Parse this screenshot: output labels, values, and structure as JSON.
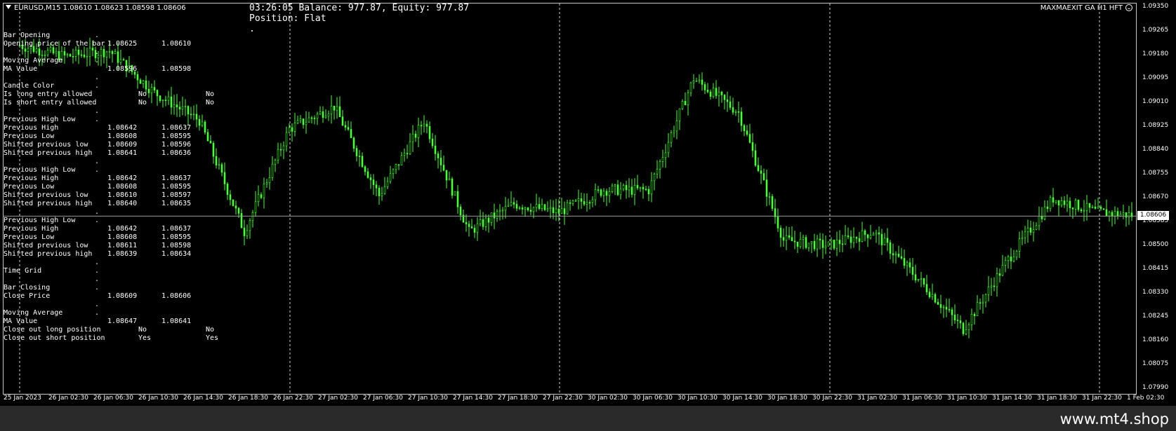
{
  "header": {
    "symbol_info": "EURUSD,M15  1.08610 1.08623 1.08598 1.08606",
    "ea_name": "MAXMAEXIT GA H1 HFT",
    "ea_icon": "smiley-icon"
  },
  "status": {
    "line1": "03:26:05 Balance: 977.87, Equity: 977.87",
    "line2": "Position: Flat",
    "line3": "."
  },
  "panel": {
    "rows": [
      {
        "label": "Bar Opening",
        "dot": "."
      },
      {
        "label": "Opening price of the bar",
        "v1": "1.08625",
        "v2": "1.08610"
      },
      {
        "label": "",
        "dot": "."
      },
      {
        "label": "Moving Average",
        "dot": "."
      },
      {
        "label": "MA Value",
        "v1": "1.08596",
        "v2": "1.08598"
      },
      {
        "label": "",
        "dot": "."
      },
      {
        "label": "Candle Color",
        "dot": "."
      },
      {
        "label": "Is long entry allowed",
        "b1": "No",
        "b2": "No"
      },
      {
        "label": "Is short entry allowed",
        "b1": "No",
        "b2": "No"
      },
      {
        "label": "",
        "dot": "."
      },
      {
        "label": "Previous High Low",
        "dot": "."
      },
      {
        "label": "Previous High",
        "v1": "1.08642",
        "v2": "1.08637"
      },
      {
        "label": "Previous Low",
        "v1": "1.08608",
        "v2": "1.08595"
      },
      {
        "label": "Shifted previous low",
        "v1": "1.08609",
        "v2": "1.08596"
      },
      {
        "label": "Shifted previous high",
        "v1": "1.08641",
        "v2": "1.08636"
      },
      {
        "label": "",
        "dot": "."
      },
      {
        "label": "Previous High Low",
        "dot": "."
      },
      {
        "label": "Previous High",
        "v1": "1.08642",
        "v2": "1.08637"
      },
      {
        "label": "Previous Low",
        "v1": "1.08608",
        "v2": "1.08595"
      },
      {
        "label": "Shifted previous low",
        "v1": "1.08610",
        "v2": "1.08597"
      },
      {
        "label": "Shifted previous high",
        "v1": "1.08640",
        "v2": "1.08635"
      },
      {
        "label": "",
        "dot": "."
      },
      {
        "label": "Previous High Low",
        "dot": "."
      },
      {
        "label": "Previous High",
        "v1": "1.08642",
        "v2": "1.08637"
      },
      {
        "label": "Previous Low",
        "v1": "1.08608",
        "v2": "1.08595"
      },
      {
        "label": "Shifted previous low",
        "v1": "1.08611",
        "v2": "1.08598"
      },
      {
        "label": "Shifted previous high",
        "v1": "1.08639",
        "v2": "1.08634"
      },
      {
        "label": "",
        "dot": "."
      },
      {
        "label": "Time Grid",
        "dot": "."
      },
      {
        "label": "",
        "dot": "."
      },
      {
        "label": "Bar Closing",
        "dot": "."
      },
      {
        "label": "Close Price",
        "v1": "1.08609",
        "v2": "1.08606"
      },
      {
        "label": "",
        "dot": "."
      },
      {
        "label": "Moving Average",
        "dot": "."
      },
      {
        "label": "MA Value",
        "v1": "1.08647",
        "v2": "1.08641"
      },
      {
        "label": "Close out long position",
        "b1": "No",
        "b2": "No"
      },
      {
        "label": "Close out short position",
        "b1": "Yes",
        "b2": "Yes"
      }
    ]
  },
  "price_axis": {
    "labels": [
      "1.09350",
      "1.09265",
      "1.09180",
      "1.09095",
      "1.09010",
      "1.08925",
      "1.08840",
      "1.08755",
      "1.08670",
      "1.08585",
      "1.08500",
      "1.08415",
      "1.08330",
      "1.08245",
      "1.08160",
      "1.08075",
      "1.07990"
    ],
    "current_price": "1.08606"
  },
  "time_axis": {
    "labels": [
      "25 Jan 2023",
      "26 Jan 02:30",
      "26 Jan 06:30",
      "26 Jan 10:30",
      "26 Jan 14:30",
      "26 Jan 18:30",
      "26 Jan 22:30",
      "27 Jan 02:30",
      "27 Jan 06:30",
      "27 Jan 10:30",
      "27 Jan 14:30",
      "27 Jan 18:30",
      "27 Jan 22:30",
      "30 Jan 02:30",
      "30 Jan 06:30",
      "30 Jan 10:30",
      "30 Jan 14:30",
      "30 Jan 18:30",
      "30 Jan 22:30",
      "31 Jan 02:30",
      "31 Jan 06:30",
      "31 Jan 10:30",
      "31 Jan 14:30",
      "31 Jan 18:30",
      "31 Jan 22:30",
      "1 Feb 02:30"
    ]
  },
  "chart_data": {
    "type": "candlestick",
    "symbol": "EURUSD",
    "timeframe": "M15",
    "ylim": [
      1.0799,
      1.0935
    ],
    "candle_color": "#4cff3a",
    "current_price": 1.08606,
    "path": [
      [
        "25 Jan 2023",
        1.0922
      ],
      [
        "26 Jan 02:30",
        1.0918
      ],
      [
        "26 Jan 06:30",
        1.092
      ],
      [
        "26 Jan 10:30",
        1.0905
      ],
      [
        "26 Jan 14:30",
        1.0895
      ],
      [
        "26 Jan 18:30",
        1.0855
      ],
      [
        "26 Jan 22:30",
        1.0892
      ],
      [
        "27 Jan 02:30",
        1.09
      ],
      [
        "27 Jan 06:30",
        1.0868
      ],
      [
        "27 Jan 10:30",
        1.0895
      ],
      [
        "27 Jan 14:30",
        1.0855
      ],
      [
        "27 Jan 18:30",
        1.0865
      ],
      [
        "27 Jan 22:30",
        1.0862
      ],
      [
        "30 Jan 02:30",
        1.087
      ],
      [
        "30 Jan 06:30",
        1.087
      ],
      [
        "30 Jan 10:30",
        1.091
      ],
      [
        "30 Jan 14:30",
        1.0898
      ],
      [
        "30 Jan 18:30",
        1.0852
      ],
      [
        "30 Jan 22:30",
        1.085
      ],
      [
        "31 Jan 02:30",
        1.0855
      ],
      [
        "31 Jan 06:30",
        1.0838
      ],
      [
        "31 Jan 10:30",
        1.082
      ],
      [
        "31 Jan 14:30",
        1.0845
      ],
      [
        "31 Jan 18:30",
        1.0867
      ],
      [
        "31 Jan 22:30",
        1.0862
      ],
      [
        "1 Feb 02:30",
        1.08606
      ]
    ]
  },
  "footer": {
    "watermark": "www.mt4.shop"
  }
}
